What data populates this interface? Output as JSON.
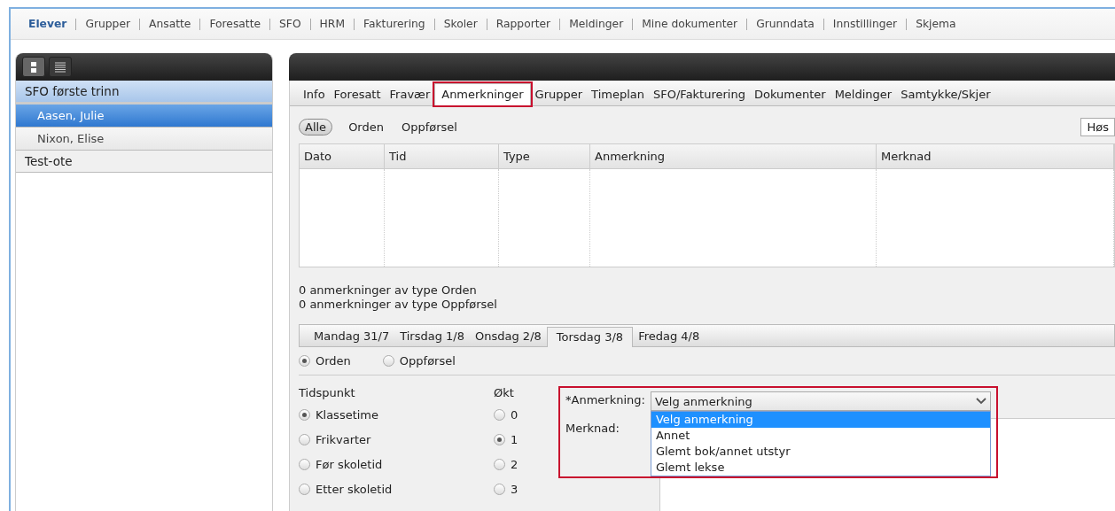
{
  "top_nav": [
    {
      "label": "Elever",
      "selected": true
    },
    {
      "label": "Grupper",
      "selected": false
    },
    {
      "label": "Ansatte",
      "selected": false
    },
    {
      "label": "Foresatte",
      "selected": false
    },
    {
      "label": "SFO",
      "selected": false
    },
    {
      "label": "HRM",
      "selected": false
    },
    {
      "label": "Fakturering",
      "selected": false
    },
    {
      "label": "Skoler",
      "selected": false
    },
    {
      "label": "Rapporter",
      "selected": false
    },
    {
      "label": "Meldinger",
      "selected": false
    },
    {
      "label": "Mine dokumenter",
      "selected": false
    },
    {
      "label": "Grunndata",
      "selected": false
    },
    {
      "label": "Innstillinger",
      "selected": false
    },
    {
      "label": "Skjema",
      "selected": false
    }
  ],
  "left_panel": {
    "view_toggles": [
      {
        "kind": "tiles",
        "selected": true
      },
      {
        "kind": "list",
        "selected": false
      }
    ],
    "groups": [
      {
        "name": "SFO første trinn",
        "selected": true,
        "students": [
          {
            "name": "Aasen, Julie",
            "selected": true
          },
          {
            "name": "Nixon, Elise",
            "selected": false
          }
        ]
      },
      {
        "name": "Test-ote",
        "selected": false
      }
    ]
  },
  "student_tabs": [
    {
      "label": "Info",
      "selected": false,
      "highlighted": false
    },
    {
      "label": "Foresatt",
      "selected": false,
      "highlighted": false
    },
    {
      "label": "Fravær",
      "selected": false,
      "highlighted": false
    },
    {
      "label": "Anmerkninger",
      "selected": true,
      "highlighted": true
    },
    {
      "label": "Grupper",
      "selected": false,
      "highlighted": false
    },
    {
      "label": "Timeplan",
      "selected": false,
      "highlighted": false
    },
    {
      "label": "SFO/Fakturering",
      "selected": false,
      "highlighted": false
    },
    {
      "label": "Dokumenter",
      "selected": false,
      "highlighted": false
    },
    {
      "label": "Meldinger",
      "selected": false,
      "highlighted": false
    },
    {
      "label": "Samtykke/Skjer",
      "selected": false,
      "highlighted": false
    }
  ],
  "filter": {
    "options": [
      {
        "label": "Alle",
        "selected": true
      },
      {
        "label": "Orden",
        "selected": false
      },
      {
        "label": "Oppførsel",
        "selected": false
      }
    ],
    "period_field": "Høs"
  },
  "table": {
    "columns": [
      "Dato",
      "Tid",
      "Type",
      "Anmerkning",
      "Merknad"
    ]
  },
  "counts": [
    "0 anmerkninger av type Orden",
    "0 anmerkninger av type Oppførsel"
  ],
  "day_tabs": [
    {
      "label": "Mandag 31/7",
      "selected": false
    },
    {
      "label": "Tirsdag 1/8",
      "selected": false
    },
    {
      "label": "Onsdag 2/8",
      "selected": false
    },
    {
      "label": "Torsdag 3/8",
      "selected": true
    },
    {
      "label": "Fredag 4/8",
      "selected": false
    }
  ],
  "category": [
    {
      "label": "Orden",
      "selected": true
    },
    {
      "label": "Oppførsel",
      "selected": false
    }
  ],
  "time_group": {
    "title": "Tidspunkt",
    "options": [
      {
        "label": "Klassetime",
        "selected": true
      },
      {
        "label": "Frikvarter",
        "selected": false
      },
      {
        "label": "Før skoletid",
        "selected": false
      },
      {
        "label": "Etter skoletid",
        "selected": false
      }
    ]
  },
  "session_group": {
    "title": "Økt",
    "options": [
      {
        "label": "0",
        "selected": false
      },
      {
        "label": "1",
        "selected": true
      },
      {
        "label": "2",
        "selected": false
      },
      {
        "label": "3",
        "selected": false
      }
    ]
  },
  "form": {
    "highlighted": true,
    "remark_label": "*Anmerkning:",
    "remark_value": "Velg anmerkning",
    "remark_options": [
      {
        "label": "Velg anmerkning",
        "selected": true
      },
      {
        "label": "Annet",
        "selected": false
      },
      {
        "label": "Glemt bok/annet utstyr",
        "selected": false
      },
      {
        "label": "Glemt lekse",
        "selected": false
      }
    ],
    "note_label": "Merknad:"
  }
}
